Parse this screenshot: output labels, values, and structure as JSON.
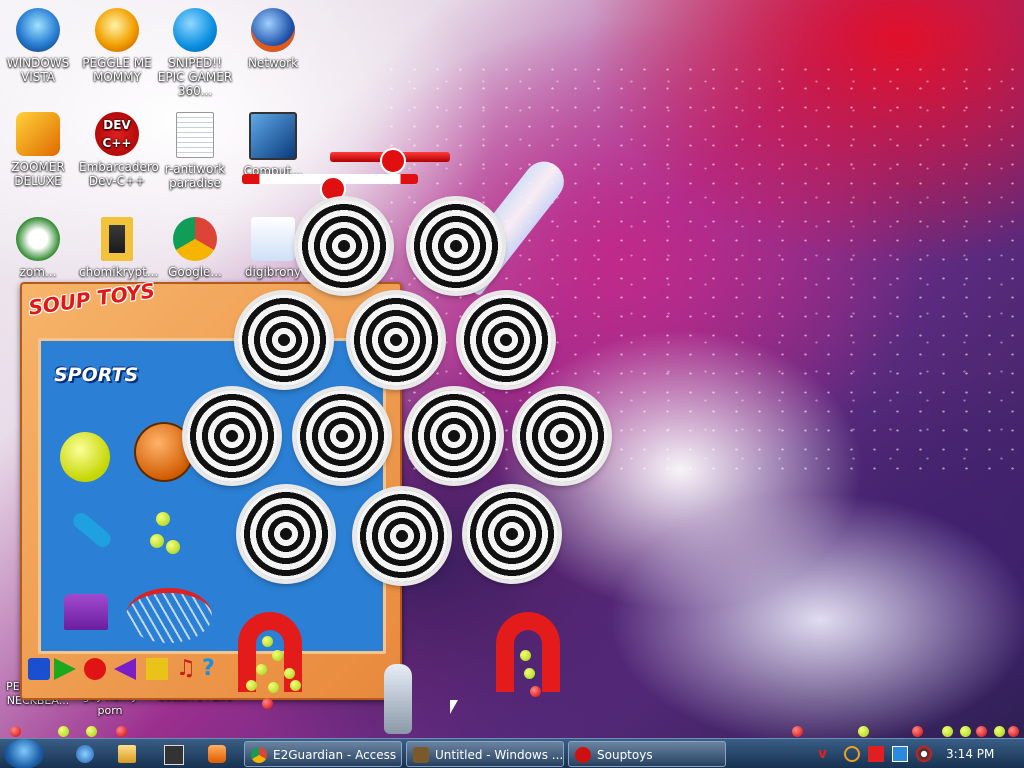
{
  "desktop": {
    "icons": [
      {
        "label": "WINDOWS VISTA",
        "icon": "vista-orb-icon"
      },
      {
        "label": "PEGGLE ME MOMMY",
        "icon": "peggle-icon"
      },
      {
        "label": "SNIPED!! EPIC GAMER 360...",
        "icon": "skype-icon"
      },
      {
        "label": "Network",
        "icon": "network-globe-icon"
      },
      {
        "label": "ZOOMER DELUXE",
        "icon": "zoomer-icon"
      },
      {
        "label": "Embarcadero Dev-C++",
        "icon": "devcpp-icon"
      },
      {
        "label": "r-antiwork paradise",
        "icon": "document-icon"
      },
      {
        "label": "Comput...",
        "icon": "computer-icon"
      },
      {
        "label": "zom...",
        "icon": "flower-icon"
      },
      {
        "label": "chomikrypt...",
        "icon": "lock-file-icon"
      },
      {
        "label": "Google...",
        "icon": "chrome-icon"
      },
      {
        "label": "digibrony",
        "icon": "digibrony-icon"
      },
      {
        "label": "PEGGLE ME NECKBEA...",
        "icon": "peggle-icon"
      },
      {
        "label": "gay horny porn",
        "icon": "folder-icon"
      },
      {
        "label": "Cotton's Pairs",
        "icon": "game-icon"
      }
    ],
    "devcpp_glyph": "DEV C++"
  },
  "soup_toys": {
    "logo": "SOUP TOYS",
    "category": "SPORTS",
    "toolbar": [
      {
        "name": "pump-button",
        "color": "#1a4fd0"
      },
      {
        "name": "play-button",
        "color": "#1ea81e"
      },
      {
        "name": "record-button",
        "color": "#e01414"
      },
      {
        "name": "rewind-button",
        "color": "#7a1ec8"
      },
      {
        "name": "stop-button",
        "color": "#e8c41a"
      },
      {
        "name": "music-button",
        "color": "#c81a1a"
      },
      {
        "name": "help-button",
        "color": "#1a8fe0"
      }
    ]
  },
  "taskbar": {
    "tasks": [
      {
        "label": "E2Guardian - Access ...",
        "icon": "chrome-icon",
        "color": "#e4b51f"
      },
      {
        "label": "Untitled - Windows ...",
        "icon": "movie-maker-icon",
        "color": "#7a5a2a"
      },
      {
        "label": "Souptoys",
        "icon": "souptoys-icon",
        "color": "#d01010"
      }
    ],
    "clock": "3:14 PM"
  }
}
